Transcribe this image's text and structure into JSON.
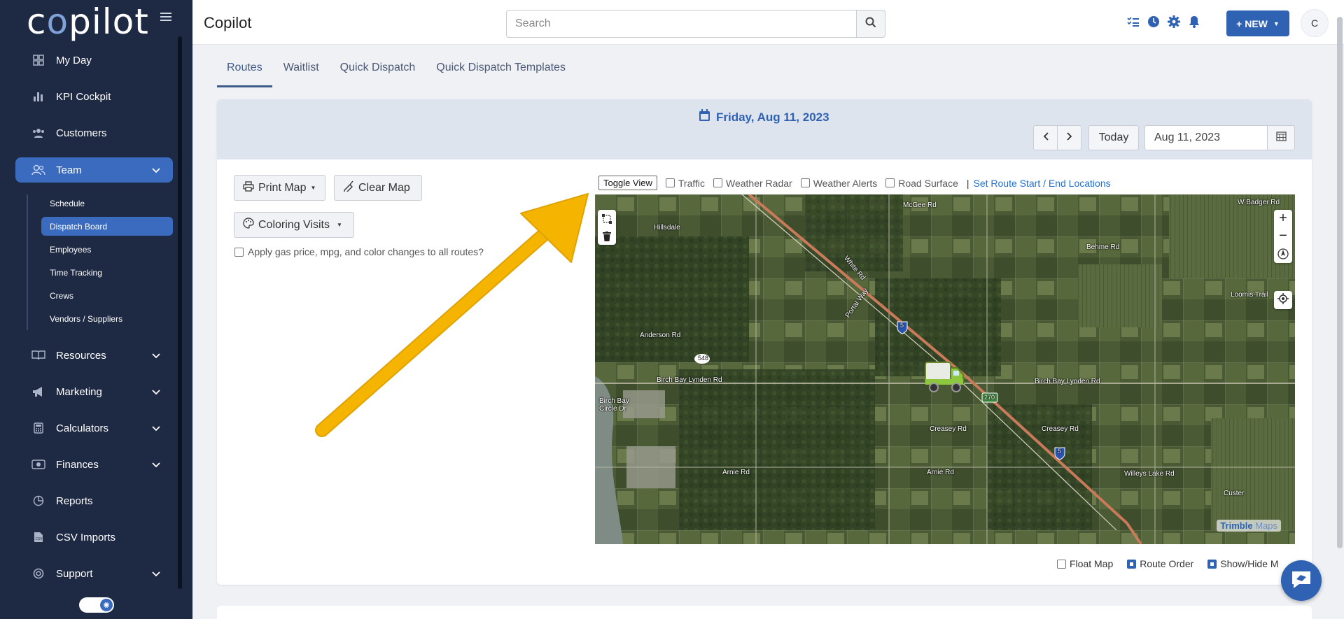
{
  "sidebar": {
    "logo": "copilot",
    "items": [
      {
        "label": "My Day",
        "icon": "grid-icon"
      },
      {
        "label": "KPI Cockpit",
        "icon": "bar-chart-icon"
      },
      {
        "label": "Customers",
        "icon": "users-icon"
      },
      {
        "label": "Team",
        "icon": "team-icon"
      },
      {
        "label": "Resources",
        "icon": "book-icon"
      },
      {
        "label": "Marketing",
        "icon": "megaphone-icon"
      },
      {
        "label": "Calculators",
        "icon": "calculator-icon"
      },
      {
        "label": "Finances",
        "icon": "money-icon"
      },
      {
        "label": "Reports",
        "icon": "pie-chart-icon"
      },
      {
        "label": "CSV Imports",
        "icon": "csv-file-icon"
      },
      {
        "label": "Support",
        "icon": "life-ring-icon"
      }
    ],
    "team_sub": [
      "Schedule",
      "Dispatch Board",
      "Employees",
      "Time Tracking",
      "Crews",
      "Vendors / Suppliers"
    ],
    "active_sub": "Dispatch Board"
  },
  "topbar": {
    "title": "Copilot",
    "search_placeholder": "Search",
    "new_label": "+ NEW",
    "avatar_initial": "C"
  },
  "tabs": [
    "Routes",
    "Waitlist",
    "Quick Dispatch",
    "Quick Dispatch Templates"
  ],
  "active_tab": "Routes",
  "header": {
    "date_title": "Friday, Aug 11, 2023",
    "today_label": "Today",
    "date_value": "Aug 11, 2023"
  },
  "controls": {
    "print_map": "Print Map",
    "clear_map": "Clear Map",
    "coloring_visits": "Coloring Visits",
    "apply_all": "Apply gas price, mpg, and color changes to all routes?"
  },
  "map_toolbar": {
    "toggle_view": "Toggle View",
    "options": [
      "Traffic",
      "Weather Radar",
      "Weather Alerts",
      "Road Surface"
    ],
    "separator": "|",
    "route_link": "Set Route Start / End Locations"
  },
  "map": {
    "labels": [
      "W Badger Rd",
      "McGee Rd",
      "Hillsdale",
      "Behme Rd",
      "Loomis Trail",
      "Anderson Rd",
      "548",
      "Birch Bay Lynden Rd",
      "Birch Bay Circle Dr",
      "270",
      "Birch Bay Lynden Rd",
      "Creasey Rd",
      "Creasey Rd",
      "Arnie Rd",
      "Arnie Rd",
      "Willeys Lake Rd",
      "5",
      "5",
      "Portal Way",
      "White Rd",
      "Custer"
    ],
    "attribution_brand": "Trimble",
    "attribution_suffix": "Maps"
  },
  "bottom_options": [
    {
      "label": "Float Map",
      "checked": false
    },
    {
      "label": "Route Order",
      "checked": true
    },
    {
      "label": "Show/Hide M",
      "checked": true
    }
  ],
  "colors": {
    "sidebar_bg": "#1e2a44",
    "accent": "#2f62b3",
    "arrow": "#f5b400"
  }
}
